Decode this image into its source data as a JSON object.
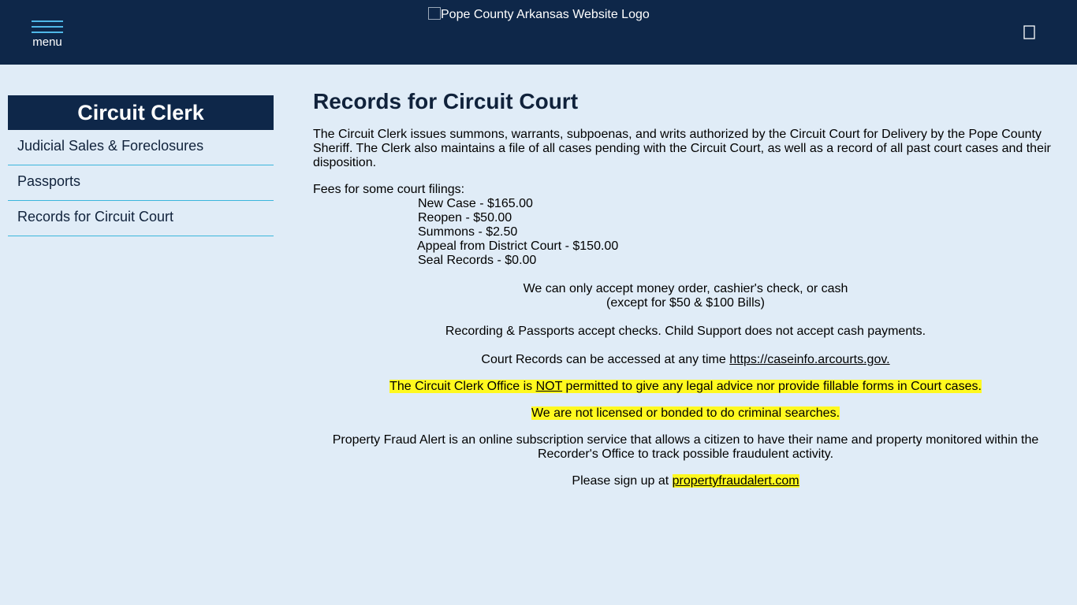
{
  "header": {
    "menu_label": "menu",
    "logo_alt": "Pope County Arkansas Website Logo",
    "icons": {
      "menu": "hamburger-icon",
      "search": "search-icon"
    },
    "colors": {
      "background": "#0e2749",
      "accent": "#4fb8e8"
    }
  },
  "sidebar": {
    "title": "Circuit Clerk",
    "items": [
      {
        "label": "Judicial Sales & Foreclosures"
      },
      {
        "label": "Passports"
      },
      {
        "label": "Records for Circuit Court"
      }
    ]
  },
  "main": {
    "title": "Records for Circuit Court",
    "intro": "The Circuit Clerk issues summons, warrants, subpoenas, and writs authorized by the Circuit Court for Delivery by the Pope County Sheriff. The Clerk also maintains a file of all cases pending with the Circuit Court, as well as a record of all past court cases and their disposition.",
    "fees_intro": "Fees for some court filings:",
    "fees": [
      "New Case - $165.00",
      "Reopen - $50.00",
      "Summons - $2.50",
      "Appeal from District Court - $150.00",
      "Seal Records - $0.00"
    ],
    "payment_line1": "We can only accept money order, cashier's check, or cash",
    "payment_line2": "(except for $50 & $100 Bills)",
    "checks_note": "Recording & Passports accept checks. Child Support does not accept cash payments.",
    "records_prefix": "Court Records can be accessed at any time ",
    "records_link": "https://caseinfo.arcourts.gov.",
    "advice_part1": "The Circuit Clerk Office is ",
    "advice_not": "NOT",
    "advice_part2": " permitted to give any legal advice nor provide fillable forms in Court cases.",
    "license_note": "We are not licensed or bonded to do criminal searches.",
    "fraud_alert": "Property Fraud Alert is an online subscription service that allows a citizen to have their name and property monitored within the Recorder's Office to track possible fraudulent activity.",
    "signup_prefix": "Please sign up at ",
    "signup_link": "propertyfraudalert.com",
    "highlight_color": "#fff91f"
  }
}
